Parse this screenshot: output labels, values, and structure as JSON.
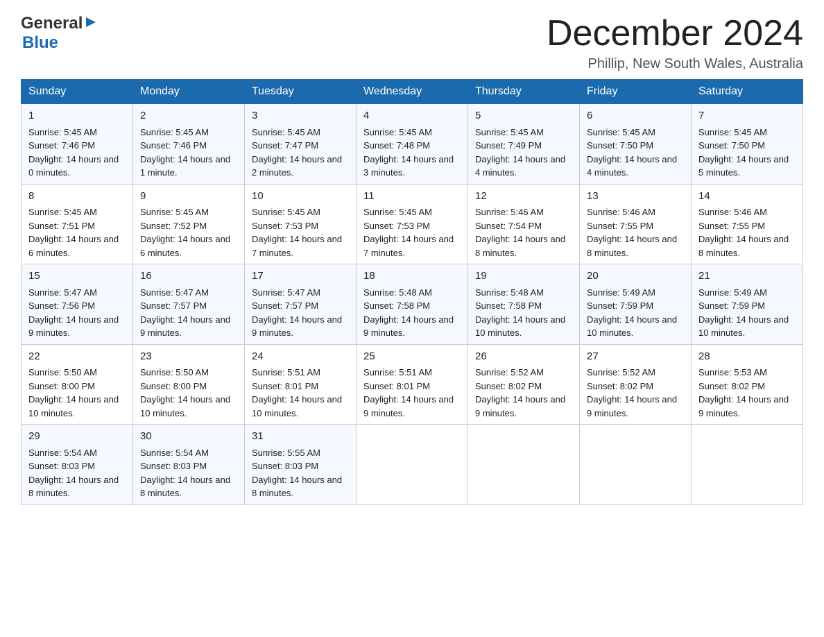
{
  "logo": {
    "general": "General",
    "blue": "Blue",
    "arrow": "▶"
  },
  "title": "December 2024",
  "subtitle": "Phillip, New South Wales, Australia",
  "days": [
    "Sunday",
    "Monday",
    "Tuesday",
    "Wednesday",
    "Thursday",
    "Friday",
    "Saturday"
  ],
  "weeks": [
    [
      {
        "num": "1",
        "sunrise": "5:45 AM",
        "sunset": "7:46 PM",
        "daylight": "14 hours and 0 minutes."
      },
      {
        "num": "2",
        "sunrise": "5:45 AM",
        "sunset": "7:46 PM",
        "daylight": "14 hours and 1 minute."
      },
      {
        "num": "3",
        "sunrise": "5:45 AM",
        "sunset": "7:47 PM",
        "daylight": "14 hours and 2 minutes."
      },
      {
        "num": "4",
        "sunrise": "5:45 AM",
        "sunset": "7:48 PM",
        "daylight": "14 hours and 3 minutes."
      },
      {
        "num": "5",
        "sunrise": "5:45 AM",
        "sunset": "7:49 PM",
        "daylight": "14 hours and 4 minutes."
      },
      {
        "num": "6",
        "sunrise": "5:45 AM",
        "sunset": "7:50 PM",
        "daylight": "14 hours and 4 minutes."
      },
      {
        "num": "7",
        "sunrise": "5:45 AM",
        "sunset": "7:50 PM",
        "daylight": "14 hours and 5 minutes."
      }
    ],
    [
      {
        "num": "8",
        "sunrise": "5:45 AM",
        "sunset": "7:51 PM",
        "daylight": "14 hours and 6 minutes."
      },
      {
        "num": "9",
        "sunrise": "5:45 AM",
        "sunset": "7:52 PM",
        "daylight": "14 hours and 6 minutes."
      },
      {
        "num": "10",
        "sunrise": "5:45 AM",
        "sunset": "7:53 PM",
        "daylight": "14 hours and 7 minutes."
      },
      {
        "num": "11",
        "sunrise": "5:45 AM",
        "sunset": "7:53 PM",
        "daylight": "14 hours and 7 minutes."
      },
      {
        "num": "12",
        "sunrise": "5:46 AM",
        "sunset": "7:54 PM",
        "daylight": "14 hours and 8 minutes."
      },
      {
        "num": "13",
        "sunrise": "5:46 AM",
        "sunset": "7:55 PM",
        "daylight": "14 hours and 8 minutes."
      },
      {
        "num": "14",
        "sunrise": "5:46 AM",
        "sunset": "7:55 PM",
        "daylight": "14 hours and 8 minutes."
      }
    ],
    [
      {
        "num": "15",
        "sunrise": "5:47 AM",
        "sunset": "7:56 PM",
        "daylight": "14 hours and 9 minutes."
      },
      {
        "num": "16",
        "sunrise": "5:47 AM",
        "sunset": "7:57 PM",
        "daylight": "14 hours and 9 minutes."
      },
      {
        "num": "17",
        "sunrise": "5:47 AM",
        "sunset": "7:57 PM",
        "daylight": "14 hours and 9 minutes."
      },
      {
        "num": "18",
        "sunrise": "5:48 AM",
        "sunset": "7:58 PM",
        "daylight": "14 hours and 9 minutes."
      },
      {
        "num": "19",
        "sunrise": "5:48 AM",
        "sunset": "7:58 PM",
        "daylight": "14 hours and 10 minutes."
      },
      {
        "num": "20",
        "sunrise": "5:49 AM",
        "sunset": "7:59 PM",
        "daylight": "14 hours and 10 minutes."
      },
      {
        "num": "21",
        "sunrise": "5:49 AM",
        "sunset": "7:59 PM",
        "daylight": "14 hours and 10 minutes."
      }
    ],
    [
      {
        "num": "22",
        "sunrise": "5:50 AM",
        "sunset": "8:00 PM",
        "daylight": "14 hours and 10 minutes."
      },
      {
        "num": "23",
        "sunrise": "5:50 AM",
        "sunset": "8:00 PM",
        "daylight": "14 hours and 10 minutes."
      },
      {
        "num": "24",
        "sunrise": "5:51 AM",
        "sunset": "8:01 PM",
        "daylight": "14 hours and 10 minutes."
      },
      {
        "num": "25",
        "sunrise": "5:51 AM",
        "sunset": "8:01 PM",
        "daylight": "14 hours and 9 minutes."
      },
      {
        "num": "26",
        "sunrise": "5:52 AM",
        "sunset": "8:02 PM",
        "daylight": "14 hours and 9 minutes."
      },
      {
        "num": "27",
        "sunrise": "5:52 AM",
        "sunset": "8:02 PM",
        "daylight": "14 hours and 9 minutes."
      },
      {
        "num": "28",
        "sunrise": "5:53 AM",
        "sunset": "8:02 PM",
        "daylight": "14 hours and 9 minutes."
      }
    ],
    [
      {
        "num": "29",
        "sunrise": "5:54 AM",
        "sunset": "8:03 PM",
        "daylight": "14 hours and 8 minutes."
      },
      {
        "num": "30",
        "sunrise": "5:54 AM",
        "sunset": "8:03 PM",
        "daylight": "14 hours and 8 minutes."
      },
      {
        "num": "31",
        "sunrise": "5:55 AM",
        "sunset": "8:03 PM",
        "daylight": "14 hours and 8 minutes."
      },
      null,
      null,
      null,
      null
    ]
  ],
  "labels": {
    "sunrise": "Sunrise:",
    "sunset": "Sunset:",
    "daylight": "Daylight:"
  }
}
